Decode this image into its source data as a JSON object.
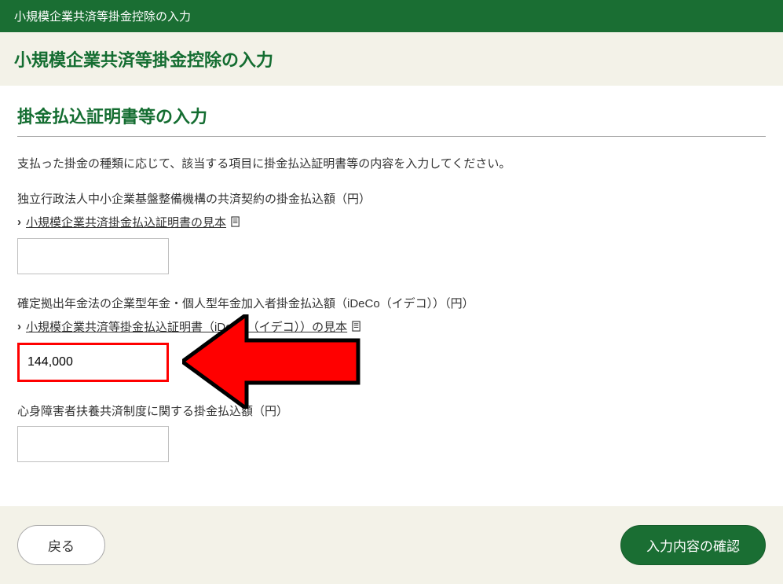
{
  "header": {
    "title": "小規模企業共済等掛金控除の入力"
  },
  "page": {
    "title": "小規模企業共済等掛金控除の入力"
  },
  "section": {
    "heading": "掛金払込証明書等の入力"
  },
  "intro": "支払った掛金の種類に応じて、該当する項目に掛金払込証明書等の内容を入力してください。",
  "fields": {
    "kyosai": {
      "label": "独立行政法人中小企業基盤整備機構の共済契約の掛金払込額（円）",
      "sample_link": "小規模企業共済掛金払込証明書の見本",
      "value": ""
    },
    "ideco": {
      "label": "確定拠出年金法の企業型年金・個人型年金加入者掛金払込額（iDeCo（イデコ））（円）",
      "sample_link": "小規模企業共済等掛金払込証明書（iDeCo（イデコ））の見本",
      "value": "144,000"
    },
    "shinshin": {
      "label": "心身障害者扶養共済制度に関する掛金払込額（円）",
      "value": ""
    }
  },
  "footer": {
    "back": "戻る",
    "confirm": "入力内容の確認"
  }
}
